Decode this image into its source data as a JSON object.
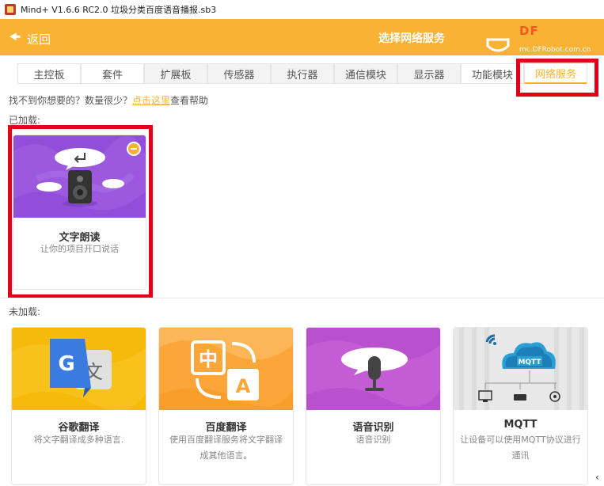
{
  "window": {
    "title": "Mind+ V1.6.6 RC2.0   垃圾分类百度语音播报.sb3"
  },
  "header": {
    "back_label": "返回",
    "title": "选择网络服务",
    "logo_text_1": "DF",
    "logo_url": "mc.DFRobot.com.cn"
  },
  "tabs": [
    {
      "label": "主控板",
      "style": "white"
    },
    {
      "label": "套件",
      "style": "white"
    },
    {
      "label": "扩展板",
      "style": "gray"
    },
    {
      "label": "传感器",
      "style": "gray"
    },
    {
      "label": "执行器",
      "style": "gray"
    },
    {
      "label": "通信模块",
      "style": "gray"
    },
    {
      "label": "显示器",
      "style": "gray"
    },
    {
      "label": "功能模块",
      "style": "white"
    },
    {
      "label": "网络服务",
      "style": "active"
    }
  ],
  "help": {
    "prefix": "找不到你想要的？数量很少？",
    "link": "点击这里",
    "suffix": "查看帮助"
  },
  "loaded": {
    "label": "已加载:",
    "cards": [
      {
        "name": "文字朗读",
        "desc": "让你的项目开口说话",
        "banner_color": "#9b59e0"
      }
    ]
  },
  "unloaded": {
    "label": "未加载:",
    "cards": [
      {
        "name": "谷歌翻译",
        "desc": "将文字翻译成多种语言.",
        "banner_color": "#f7c21b"
      },
      {
        "name": "百度翻译",
        "desc": "使用百度翻译服务将文字翻译成其他语言。",
        "banner_color": "#fca63a"
      },
      {
        "name": "语音识别",
        "desc": "语音识别",
        "banner_color": "#c45cd6"
      },
      {
        "name": "MQTT",
        "desc": "让设备可以使用MQTT协议进行通讯",
        "banner_color": "#e4e4e4"
      }
    ]
  },
  "colors": {
    "accent": "#f9b233",
    "highlight": "#e5001a"
  }
}
